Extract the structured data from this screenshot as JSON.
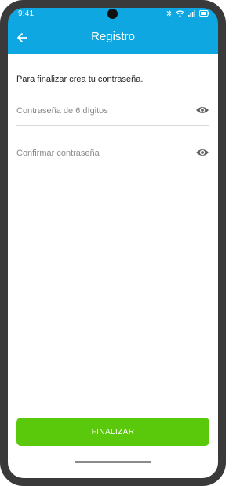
{
  "status_bar": {
    "time": "9:41",
    "icons": [
      "bluetooth-icon",
      "wifi-icon",
      "signal-icon",
      "battery-icon"
    ]
  },
  "header": {
    "title": "Registro",
    "back_icon": "arrow-left-icon"
  },
  "form": {
    "instruction": "Para finalizar crea tu contraseña.",
    "password": {
      "placeholder": "Contraseña de 6 dígitos",
      "value": "",
      "icon": "eye-icon"
    },
    "confirm": {
      "placeholder": "Confirmar contraseña",
      "value": "",
      "icon": "eye-icon"
    }
  },
  "actions": {
    "finish_label": "FINALIZAR"
  },
  "colors": {
    "appbar": "#0ea7e1",
    "primary_button": "#5ac80b",
    "bezel": "#3a3a3a"
  }
}
